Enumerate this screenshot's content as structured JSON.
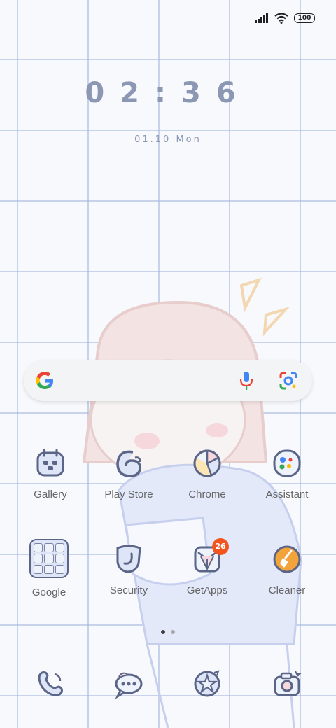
{
  "status_bar": {
    "battery": "100"
  },
  "lockscreen": {
    "time": "02:36",
    "date": "01.10 Mon"
  },
  "search": {},
  "home_row_1": [
    {
      "label": "Gallery"
    },
    {
      "label": "Play Store"
    },
    {
      "label": "Chrome"
    },
    {
      "label": "Assistant"
    }
  ],
  "home_row_2": [
    {
      "label": "Google"
    },
    {
      "label": "Security"
    },
    {
      "label": "GetApps",
      "badge": "26"
    },
    {
      "label": "Cleaner"
    }
  ],
  "dock": [
    {
      "icon": "phone-icon"
    },
    {
      "icon": "messages-icon"
    },
    {
      "icon": "browser-icon"
    },
    {
      "icon": "camera-icon"
    }
  ],
  "colors": {
    "accent": "#5b6588",
    "badge": "#f2551f",
    "grid": "#a0b4dc"
  }
}
